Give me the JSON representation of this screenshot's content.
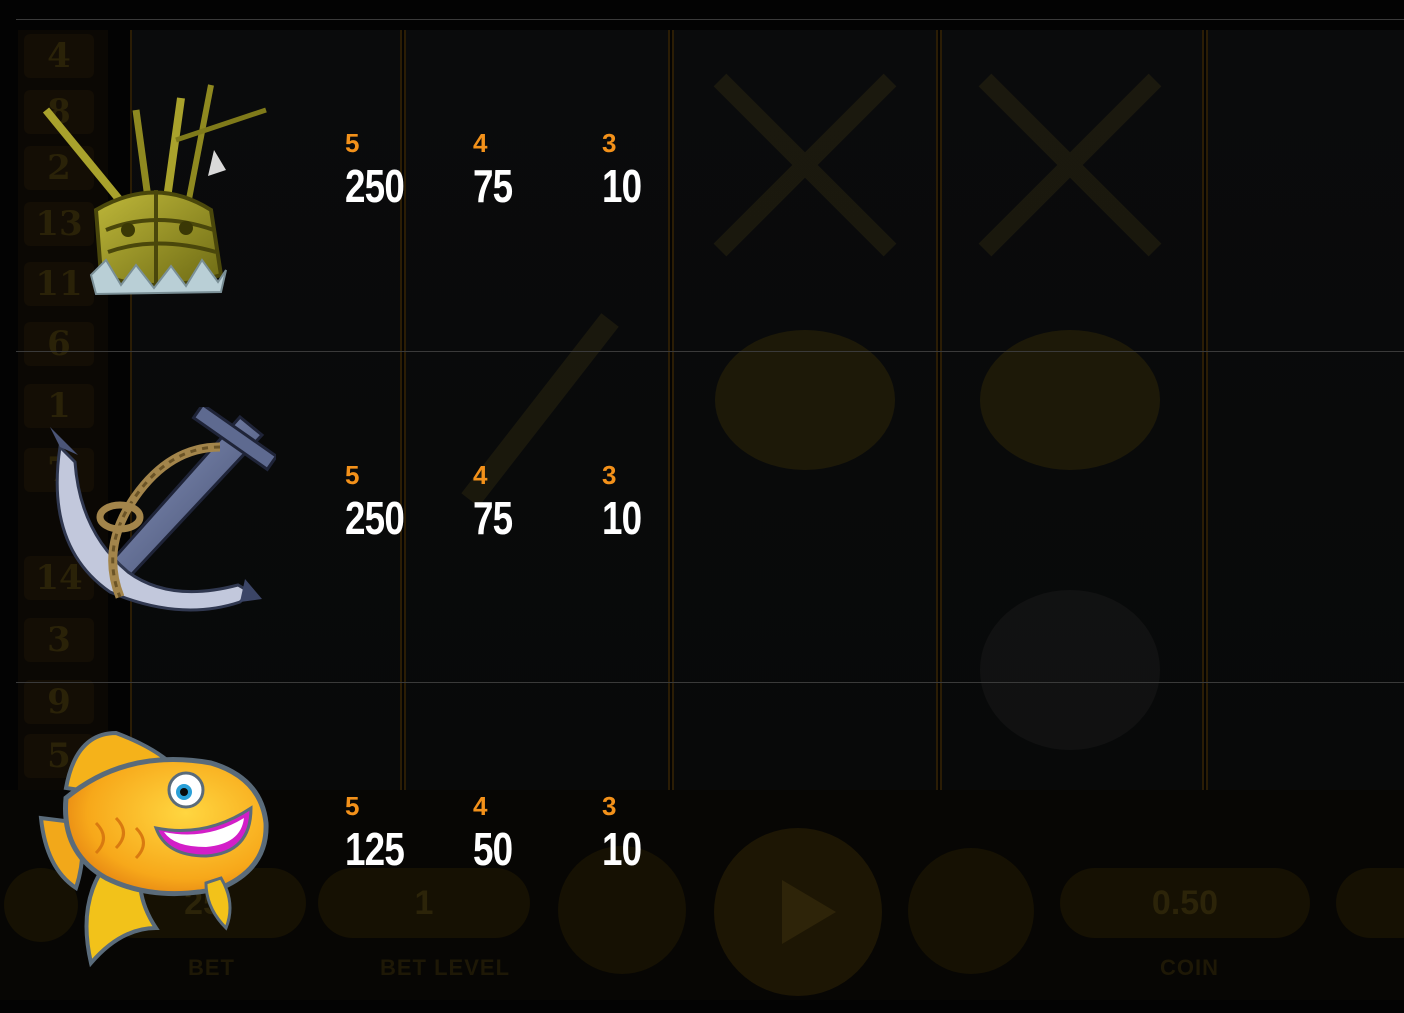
{
  "background": {
    "reel_numbers": [
      "4",
      "8",
      "2",
      "13",
      "11",
      "6",
      "1",
      "7",
      "14",
      "3",
      "9",
      "5"
    ],
    "controls": {
      "bet_value": "25",
      "bet_label": "BET",
      "bet_level_value": "1",
      "bet_level_label": "BET LEVEL",
      "coin_value": "0.50",
      "coin_label": "COIN",
      "minus": "−",
      "plus": "+"
    }
  },
  "paytable": {
    "rows": [
      {
        "symbol": "shipwreck-icon",
        "pays": [
          {
            "count": "5",
            "amount": "250"
          },
          {
            "count": "4",
            "amount": "75"
          },
          {
            "count": "3",
            "amount": "10"
          }
        ]
      },
      {
        "symbol": "anchor-icon",
        "pays": [
          {
            "count": "5",
            "amount": "250"
          },
          {
            "count": "4",
            "amount": "75"
          },
          {
            "count": "3",
            "amount": "10"
          }
        ]
      },
      {
        "symbol": "goldfish-icon",
        "pays": [
          {
            "count": "5",
            "amount": "125"
          },
          {
            "count": "4",
            "amount": "50"
          },
          {
            "count": "3",
            "amount": "10"
          }
        ]
      }
    ]
  },
  "colors": {
    "count": "#f3911a",
    "amount": "#ffffff",
    "divider": "#3a3a3a",
    "background": "#030303"
  }
}
